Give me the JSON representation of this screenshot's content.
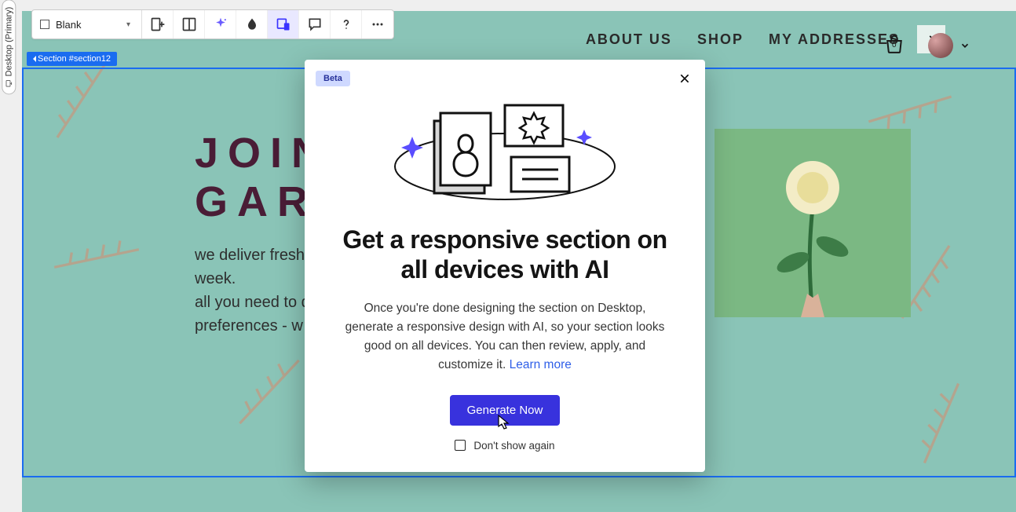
{
  "left_rail": {
    "label": "Desktop (Primary)"
  },
  "toolbar": {
    "select_label": "Blank"
  },
  "section_tag": "Section #section12",
  "site_nav": {
    "items": [
      {
        "label": "ABOUT US"
      },
      {
        "label": "SHOP"
      },
      {
        "label": "MY ADDRESSES"
      }
    ],
    "cart_badge": "0"
  },
  "hero": {
    "title_line1": "JOIN",
    "title_line2": "GAR",
    "body_line1": "we deliver fresh",
    "body_line2": "week.",
    "body_line3": "all you need to d",
    "body_line4": "preferences - w"
  },
  "modal": {
    "beta_label": "Beta",
    "title": "Get a responsive section on all devices with AI",
    "body": "Once you're done designing the section on Desktop, generate a responsive design with AI, so your section looks good on all devices. You can then review, apply, and customize it. ",
    "learn_more": "Learn more",
    "cta": "Generate Now",
    "dont_show": "Don't show again"
  }
}
